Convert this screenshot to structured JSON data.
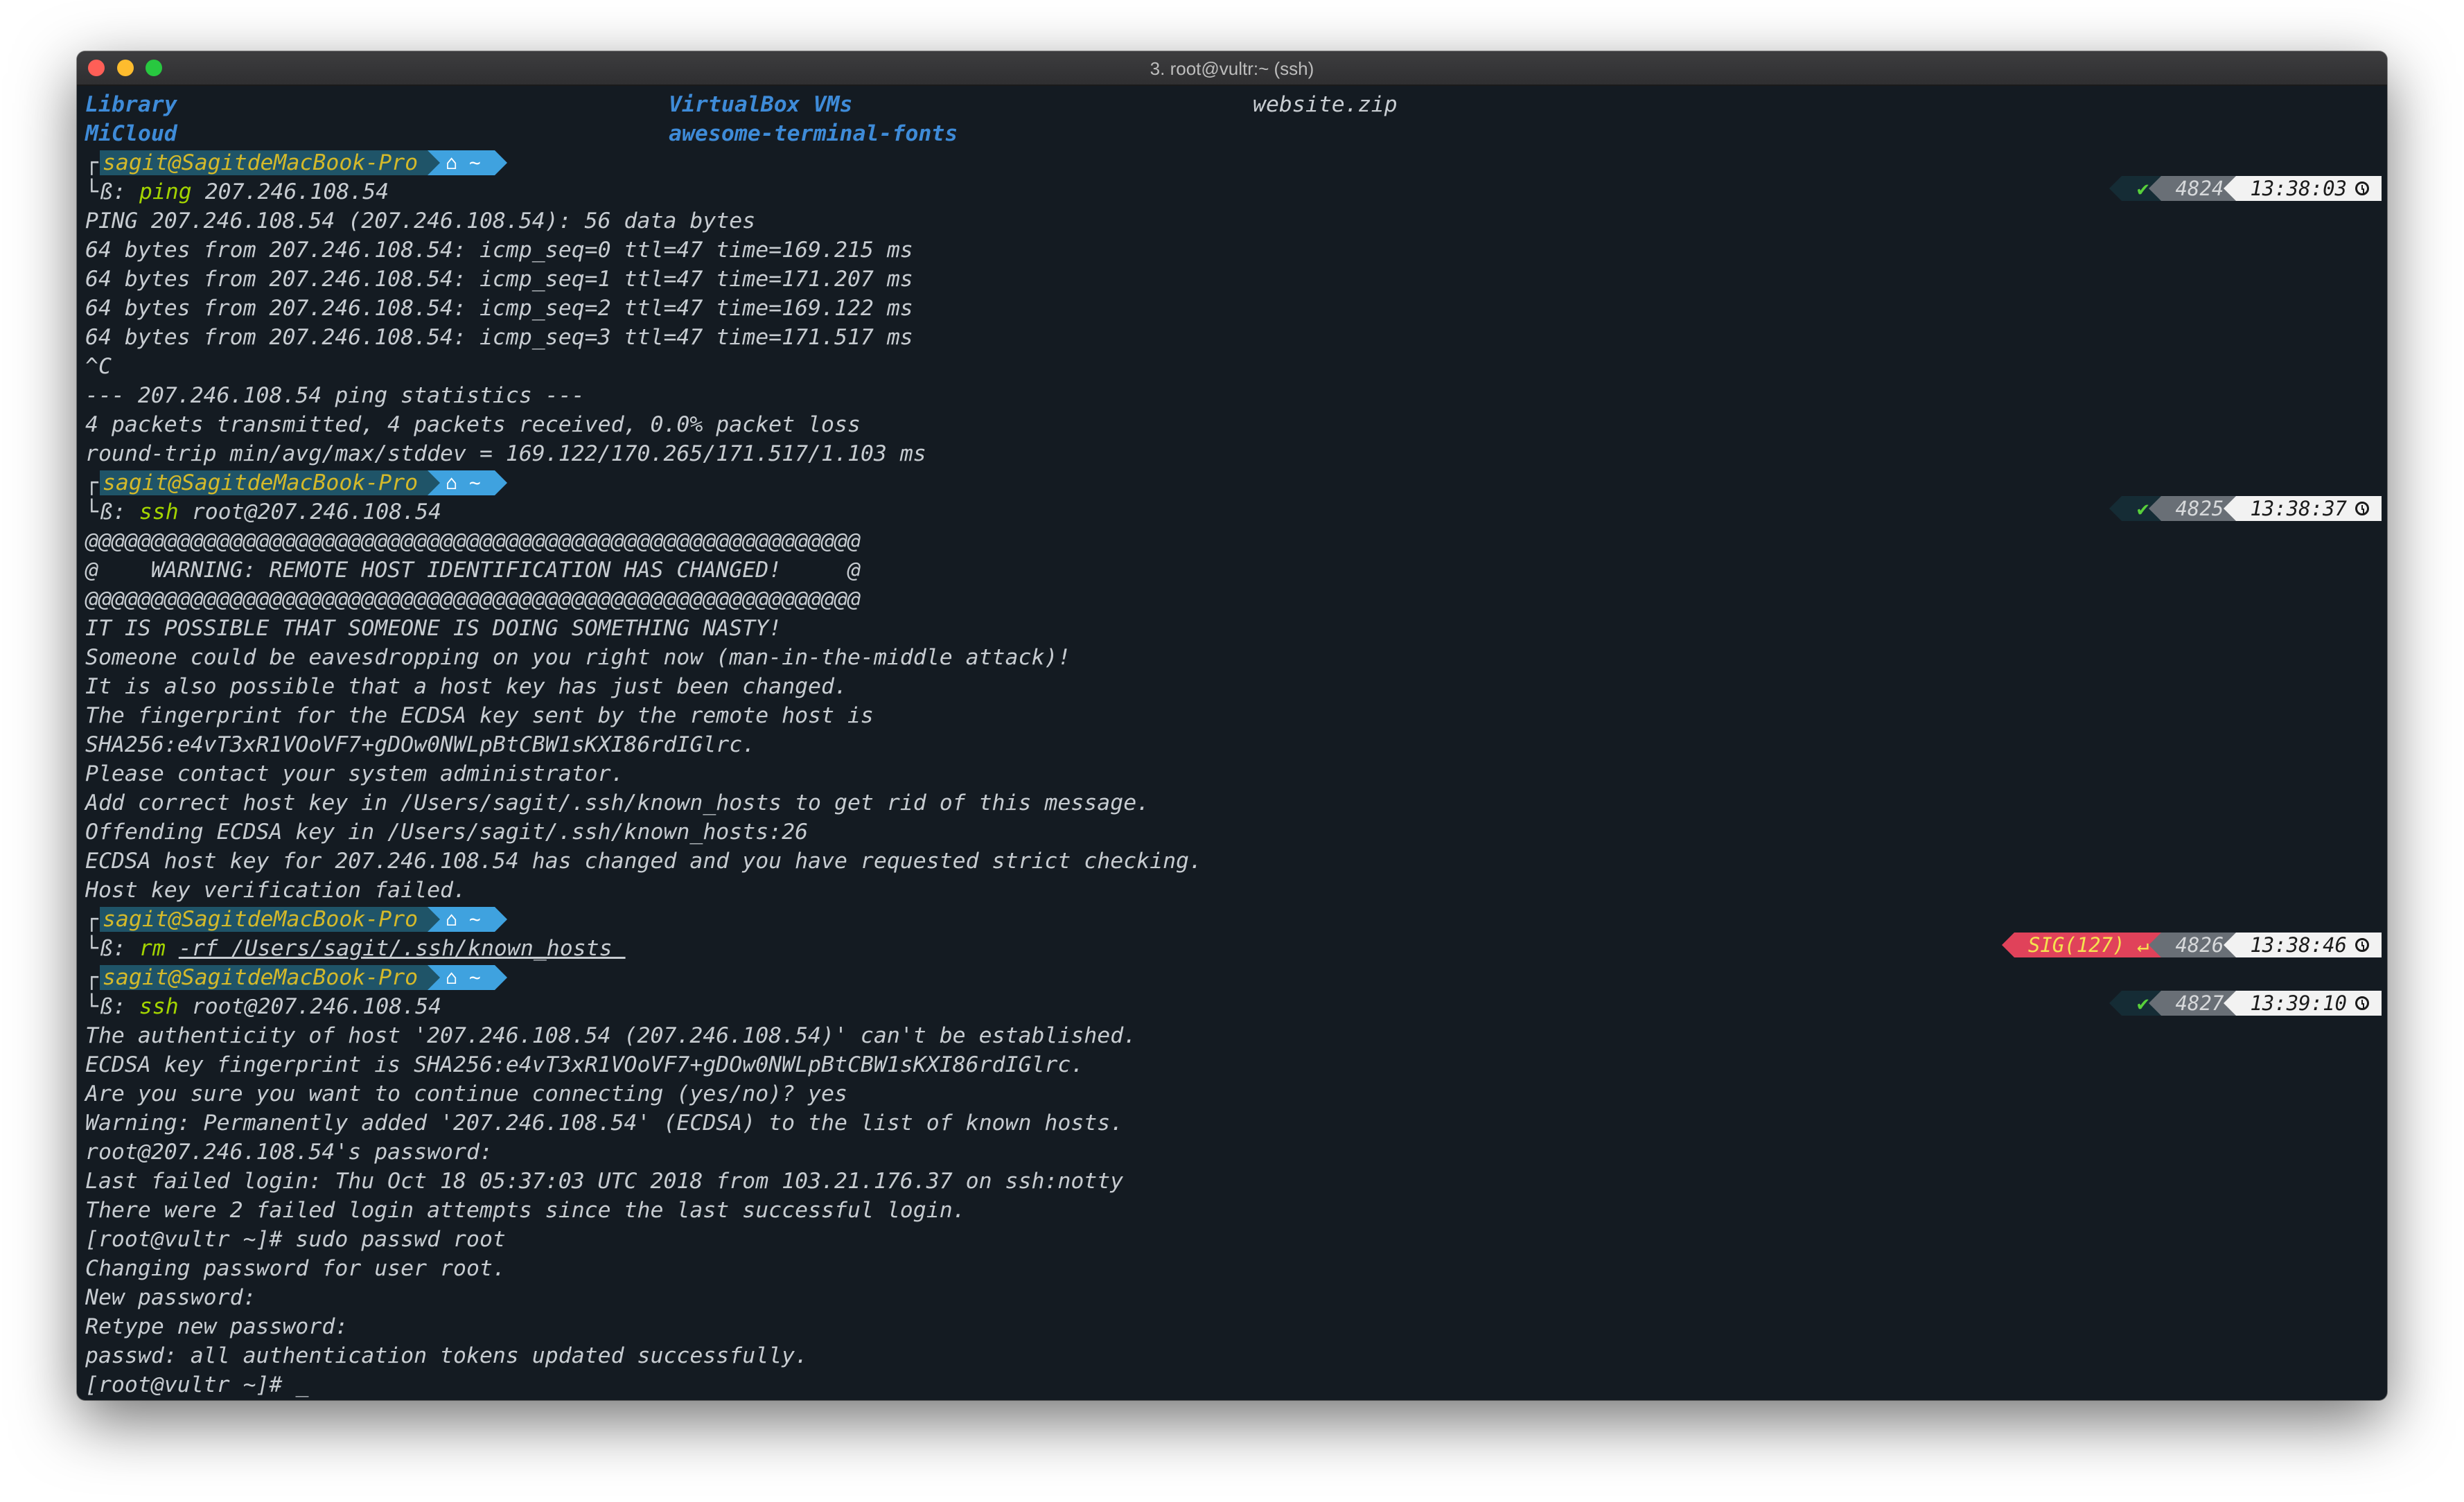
{
  "window": {
    "title": "3. root@vultr:~ (ssh)"
  },
  "listing": {
    "row1": [
      "Library",
      "VirtualBox VMs",
      "website.zip"
    ],
    "row2": [
      "MiCloud",
      "awesome-terminal-fonts"
    ]
  },
  "prompt": {
    "user_host": "sagit@SagitdeMacBook-Pro",
    "home": "~",
    "beta": "ß:"
  },
  "commands": [
    {
      "cmd": "ping",
      "args": "207.246.108.54",
      "status": "✔",
      "count": "4824",
      "time": "13:38:03"
    },
    {
      "cmd": "ssh",
      "args": "root@207.246.108.54",
      "status": "✔",
      "count": "4825",
      "time": "13:38:37"
    },
    {
      "cmd": "rm",
      "args": "-rf /Users/sagit/.ssh/known_hosts ",
      "status": "SIG(127) ↵",
      "count": "4826",
      "time": "13:38:46"
    },
    {
      "cmd": "ssh",
      "args": "root@207.246.108.54",
      "status": "✔",
      "count": "4827",
      "time": "13:39:10"
    }
  ],
  "ping_output": [
    "PING 207.246.108.54 (207.246.108.54): 56 data bytes",
    "64 bytes from 207.246.108.54: icmp_seq=0 ttl=47 time=169.215 ms",
    "64 bytes from 207.246.108.54: icmp_seq=1 ttl=47 time=171.207 ms",
    "64 bytes from 207.246.108.54: icmp_seq=2 ttl=47 time=169.122 ms",
    "64 bytes from 207.246.108.54: icmp_seq=3 ttl=47 time=171.517 ms",
    "^C",
    "--- 207.246.108.54 ping statistics ---",
    "4 packets transmitted, 4 packets received, 0.0% packet loss",
    "round-trip min/avg/max/stddev = 169.122/170.265/171.517/1.103 ms"
  ],
  "ssh_warning_output": [
    "@@@@@@@@@@@@@@@@@@@@@@@@@@@@@@@@@@@@@@@@@@@@@@@@@@@@@@@@@@@",
    "@    WARNING: REMOTE HOST IDENTIFICATION HAS CHANGED!     @",
    "@@@@@@@@@@@@@@@@@@@@@@@@@@@@@@@@@@@@@@@@@@@@@@@@@@@@@@@@@@@",
    "IT IS POSSIBLE THAT SOMEONE IS DOING SOMETHING NASTY!",
    "Someone could be eavesdropping on you right now (man-in-the-middle attack)!",
    "It is also possible that a host key has just been changed.",
    "The fingerprint for the ECDSA key sent by the remote host is",
    "SHA256:e4vT3xR1VOoVF7+gDOw0NWLpBtCBW1sKXI86rdIGlrc.",
    "Please contact your system administrator.",
    "Add correct host key in /Users/sagit/.ssh/known_hosts to get rid of this message.",
    "Offending ECDSA key in /Users/sagit/.ssh/known_hosts:26",
    "ECDSA host key for 207.246.108.54 has changed and you have requested strict checking.",
    "Host key verification failed."
  ],
  "ssh_session_output": [
    "The authenticity of host '207.246.108.54 (207.246.108.54)' can't be established.",
    "ECDSA key fingerprint is SHA256:e4vT3xR1VOoVF7+gDOw0NWLpBtCBW1sKXI86rdIGlrc.",
    "Are you sure you want to continue connecting (yes/no)? yes",
    "Warning: Permanently added '207.246.108.54' (ECDSA) to the list of known hosts.",
    "root@207.246.108.54's password:",
    "Last failed login: Thu Oct 18 05:37:03 UTC 2018 from 103.21.176.37 on ssh:notty",
    "There were 2 failed login attempts since the last successful login.",
    "[root@vultr ~]# sudo passwd root",
    "Changing password for user root.",
    "New password:",
    "Retype new password:",
    "passwd: all authentication tokens updated successfully.",
    "[root@vultr ~]# "
  ],
  "cursor": "_",
  "colors": {
    "background": "#141b22",
    "user_segment": "#1f5468",
    "home_segment": "#3fa2df",
    "command": "#a3d400",
    "error_segment": "#e0425a",
    "ok_check": "#58d03b"
  },
  "icons": {
    "home": "home-icon",
    "clock": "clock-icon"
  }
}
